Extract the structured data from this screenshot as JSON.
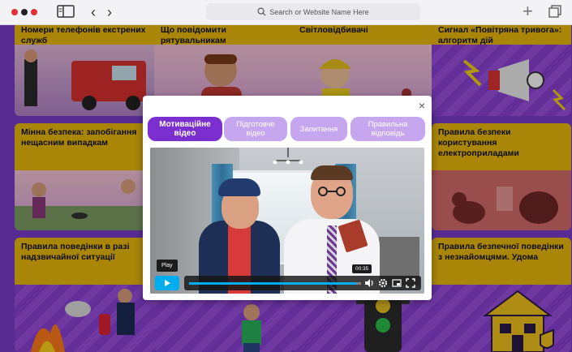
{
  "browser": {
    "address_placeholder": "Search or Website Name Here",
    "icons": [
      "window-close-dot",
      "window-minimize-dot",
      "window-maximize-dot",
      "sidebar-icon",
      "back-arrow-icon",
      "forward-arrow-icon",
      "search-icon",
      "new-tab-plus-icon",
      "tabs-overview-icon"
    ]
  },
  "cards": [
    {
      "title": "Номери телефонів екстрених служб"
    },
    {
      "title": "Що повідомити рятувальникам"
    },
    {
      "title": "Світловідбивачі"
    },
    {
      "title": "Сигнал «Повітряна тривога»: алгоритм дій"
    },
    {
      "title": "Мінна безпека: запобігання нещасним випадкам"
    },
    {
      "title": "Правила безпеки користування електроприладами"
    },
    {
      "title": "Правила поведінки в разі надзвичайної ситуації"
    },
    {
      "title": "Правила безпечної поведінки з незнайомцями. Удома"
    }
  ],
  "modal": {
    "close_label": "×",
    "tabs": [
      {
        "label": "Мотиваційне відео",
        "active": true
      },
      {
        "label": "Підготовче відео",
        "active": false
      },
      {
        "label": "Запитання",
        "active": false
      },
      {
        "label": "Правильна відповідь",
        "active": false
      }
    ],
    "player": {
      "tooltip": "Play",
      "time": "00:35",
      "progress": 0.97,
      "controls": [
        "play-icon",
        "volume-icon",
        "settings-icon",
        "pip-icon",
        "fullscreen-icon"
      ]
    }
  },
  "colors": {
    "accent_purple": "#7b2fd1",
    "tab_inactive": "#c6a6ee",
    "card_yellow": "#eab90c",
    "player_blue": "#00adef"
  }
}
